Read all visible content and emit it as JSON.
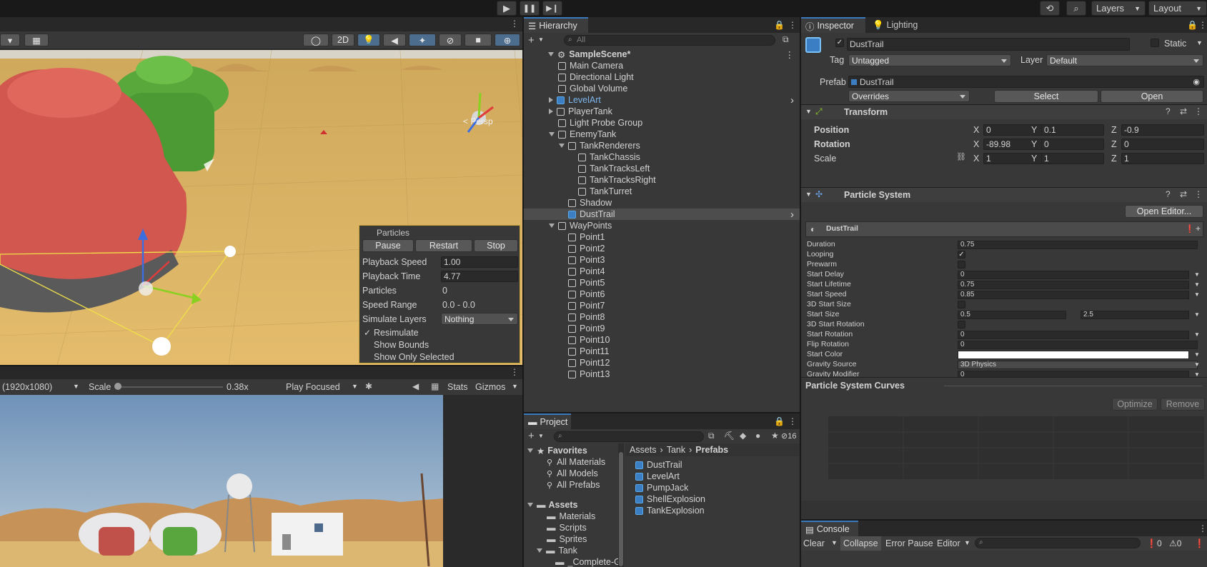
{
  "toolbar": {
    "layers": "Layers",
    "layout": "Layout"
  },
  "scene_view": {
    "btn_2d": "2D",
    "persp": "< Persp",
    "overlay": {
      "title": "Particles",
      "pause": "Pause",
      "restart": "Restart",
      "stop": "Stop",
      "rows": [
        {
          "label": "Playback Speed",
          "value": "1.00"
        },
        {
          "label": "Playback Time",
          "value": "4.77"
        },
        {
          "label": "Particles",
          "value": "0"
        },
        {
          "label": "Speed Range",
          "value": "0.0 - 0.0"
        },
        {
          "label": "Simulate Layers",
          "value": "Nothing"
        }
      ],
      "resimulate": "Resimulate",
      "show_bounds": "Show Bounds",
      "show_only_selected": "Show Only Selected"
    }
  },
  "game_view": {
    "resolution": "(1920x1080)",
    "scale_label": "Scale",
    "scale_value": "0.38x",
    "play_mode": "Play Focused",
    "stats": "Stats",
    "gizmos": "Gizmos"
  },
  "hierarchy": {
    "tab": "Hierarchy",
    "search_placeholder": "All",
    "scene": "SampleScene*",
    "items": [
      {
        "label": "Main Camera",
        "depth": 1
      },
      {
        "label": "Directional Light",
        "depth": 1
      },
      {
        "label": "Global Volume",
        "depth": 1
      },
      {
        "label": "LevelArt",
        "depth": 1,
        "prefab": true,
        "expand": "closed"
      },
      {
        "label": "PlayerTank",
        "depth": 1,
        "expand": "closed"
      },
      {
        "label": "Light Probe Group",
        "depth": 1
      },
      {
        "label": "EnemyTank",
        "depth": 1,
        "expand": "open"
      },
      {
        "label": "TankRenderers",
        "depth": 2,
        "expand": "open"
      },
      {
        "label": "TankChassis",
        "depth": 3
      },
      {
        "label": "TankTracksLeft",
        "depth": 3
      },
      {
        "label": "TankTracksRight",
        "depth": 3
      },
      {
        "label": "TankTurret",
        "depth": 3
      },
      {
        "label": "Shadow",
        "depth": 2
      },
      {
        "label": "DustTrail",
        "depth": 2,
        "prefab": true,
        "selected": true
      },
      {
        "label": "WayPoints",
        "depth": 1,
        "expand": "open"
      },
      {
        "label": "Point1",
        "depth": 2
      },
      {
        "label": "Point2",
        "depth": 2
      },
      {
        "label": "Point3",
        "depth": 2
      },
      {
        "label": "Point4",
        "depth": 2
      },
      {
        "label": "Point5",
        "depth": 2
      },
      {
        "label": "Point6",
        "depth": 2
      },
      {
        "label": "Point7",
        "depth": 2
      },
      {
        "label": "Point8",
        "depth": 2
      },
      {
        "label": "Point9",
        "depth": 2
      },
      {
        "label": "Point10",
        "depth": 2
      },
      {
        "label": "Point11",
        "depth": 2
      },
      {
        "label": "Point12",
        "depth": 2
      },
      {
        "label": "Point13",
        "depth": 2
      }
    ]
  },
  "project": {
    "tab": "Project",
    "hidden_count": "16",
    "favorites": "Favorites",
    "fav_items": [
      "All Materials",
      "All Models",
      "All Prefabs"
    ],
    "assets": "Assets",
    "asset_folders": [
      "Materials",
      "Scripts",
      "Sprites",
      "Tank",
      "_Complete-G"
    ],
    "breadcrumb": [
      "Assets",
      "Tank",
      "Prefabs"
    ],
    "files": [
      "DustTrail",
      "LevelArt",
      "PumpJack",
      "ShellExplosion",
      "TankExplosion"
    ]
  },
  "inspector": {
    "tab": "Inspector",
    "tab2": "Lighting",
    "name": "DustTrail",
    "static": "Static",
    "tag_label": "Tag",
    "tag": "Untagged",
    "layer_label": "Layer",
    "layer": "Default",
    "prefab_label": "Prefab",
    "prefab": "DustTrail",
    "overrides": "Overrides",
    "select": "Select",
    "open": "Open",
    "transform": {
      "title": "Transform",
      "rows": [
        {
          "label": "Position",
          "x": "0",
          "y": "0.1",
          "z": "-0.9"
        },
        {
          "label": "Rotation",
          "x": "-89.98",
          "y": "0",
          "z": "0"
        },
        {
          "label": "Scale",
          "x": "1",
          "y": "1",
          "z": "1"
        }
      ],
      "axes": [
        "X",
        "Y",
        "Z"
      ]
    },
    "particle_system": {
      "title": "Particle System",
      "open_editor": "Open Editor...",
      "module": "DustTrail",
      "rows": [
        {
          "label": "Duration",
          "value": "0.75",
          "type": "field"
        },
        {
          "label": "Looping",
          "value": "✓",
          "type": "check"
        },
        {
          "label": "Prewarm",
          "value": "",
          "type": "check"
        },
        {
          "label": "Start Delay",
          "value": "0",
          "type": "field"
        },
        {
          "label": "Start Lifetime",
          "value": "0.75",
          "type": "field"
        },
        {
          "label": "Start Speed",
          "value": "0.85",
          "type": "field"
        },
        {
          "label": "3D Start Size",
          "value": "",
          "type": "check"
        },
        {
          "label": "Start Size",
          "value": "0.5",
          "value2": "2.5",
          "type": "field2"
        },
        {
          "label": "3D Start Rotation",
          "value": "",
          "type": "check"
        },
        {
          "label": "Start Rotation",
          "value": "0",
          "type": "field"
        },
        {
          "label": "Flip Rotation",
          "value": "0",
          "type": "field"
        },
        {
          "label": "Start Color",
          "value": "",
          "type": "color"
        },
        {
          "label": "Gravity Source",
          "value": "3D Physics",
          "type": "drop"
        },
        {
          "label": "Gravity Modifier",
          "value": "0",
          "type": "field"
        }
      ]
    },
    "curves": {
      "title": "Particle System Curves",
      "optimize": "Optimize",
      "remove": "Remove"
    }
  },
  "console": {
    "tab": "Console",
    "clear": "Clear",
    "collapse": "Collapse",
    "error_pause": "Error Pause",
    "editor": "Editor",
    "count_warn": "0",
    "count_err": "0"
  },
  "colors": {
    "accent": "#3a79bb",
    "selection": "#4d4d4d",
    "panel": "#383838",
    "sand": "#d9b164"
  }
}
